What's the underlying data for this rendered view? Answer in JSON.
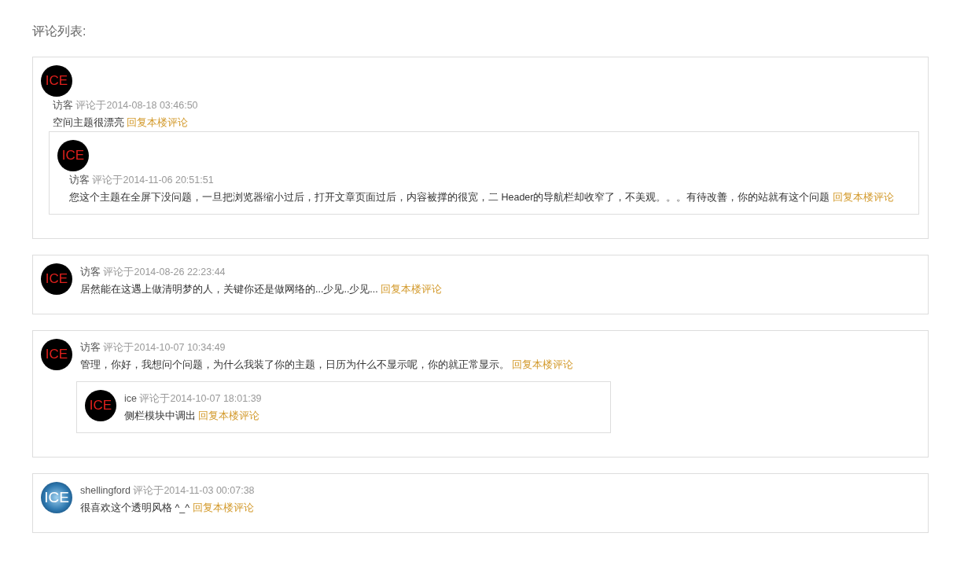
{
  "heading": "评论列表:",
  "comments": [
    {
      "kind": "stacked",
      "avatar": {
        "kind": "dark",
        "label": "ICE"
      },
      "user": "访客",
      "time": "评论于2014-08-18 03:46:50",
      "text": "空间主题很漂亮",
      "reply_link": "回复本楼评论",
      "replies": [
        {
          "kind": "stacked",
          "avatar": {
            "kind": "dark",
            "label": "ICE"
          },
          "user": "访客",
          "time": "评论于2014-11-06 20:51:51",
          "text": "您这个主题在全屏下没问题，一旦把浏览器缩小过后，打开文章页面过后，内容被撑的很宽，二 Header的导航栏却收窄了，不美观。。。有待改善，你的站就有这个问题",
          "reply_link": "回复本楼评论"
        }
      ]
    },
    {
      "kind": "side",
      "avatar": {
        "kind": "dark",
        "label": "ICE"
      },
      "user": "访客",
      "time": "评论于2014-08-26 22:23:44",
      "text": "居然能在这遇上做清明梦的人，关键你还是做网络的...少见..少见...",
      "reply_link": "回复本楼评论"
    },
    {
      "kind": "side",
      "avatar": {
        "kind": "dark",
        "label": "ICE"
      },
      "user": "访客",
      "time": "评论于2014-10-07 10:34:49",
      "text": "管理，你好，我想问个问题，为什么我装了你的主题，日历为什么不显示呢，你的就正常显示。",
      "reply_link": "回复本楼评论",
      "replies": [
        {
          "kind": "side",
          "avatar": {
            "kind": "dark",
            "label": "ICE"
          },
          "user": "ice",
          "time": "评论于2014-10-07 18:01:39",
          "text": "侧栏模块中调出",
          "reply_link": "回复本楼评论"
        }
      ]
    },
    {
      "kind": "side",
      "avatar": {
        "kind": "blue",
        "label": "ICE"
      },
      "user": "shellingford",
      "time": "评论于2014-11-03 00:07:38",
      "text": "很喜欢这个透明风格 ^_^",
      "reply_link": "回复本楼评论"
    }
  ]
}
